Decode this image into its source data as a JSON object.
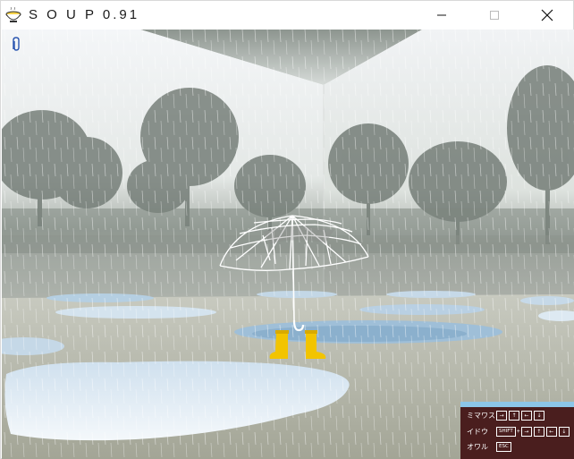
{
  "window": {
    "title": "S O U P 0.91",
    "app_icon": "soup-bowl-icon",
    "controls": [
      "minimize-icon",
      "maximize-icon",
      "close-icon"
    ]
  },
  "scene": {
    "description_icon": "paperclip-icon",
    "colors": {
      "sky": "#f2f4f6",
      "ground": "#aeb0a4",
      "puddle": "#bcd6ea",
      "boots": "#f2c400",
      "umbrella": "#ffffff",
      "help_bg": "#4a1e1e",
      "help_accent": "#8cc6e8"
    }
  },
  "help": {
    "rows": [
      {
        "label": "ミマワス",
        "keys": [
          "→",
          "↑",
          "←",
          "↓"
        ]
      },
      {
        "label": "イドウ",
        "modifier": "SHIFT",
        "plus": "+",
        "keys": [
          "→",
          "↑",
          "←",
          "↓"
        ]
      },
      {
        "label": "オワル",
        "keys": [
          "ESC"
        ]
      }
    ]
  }
}
